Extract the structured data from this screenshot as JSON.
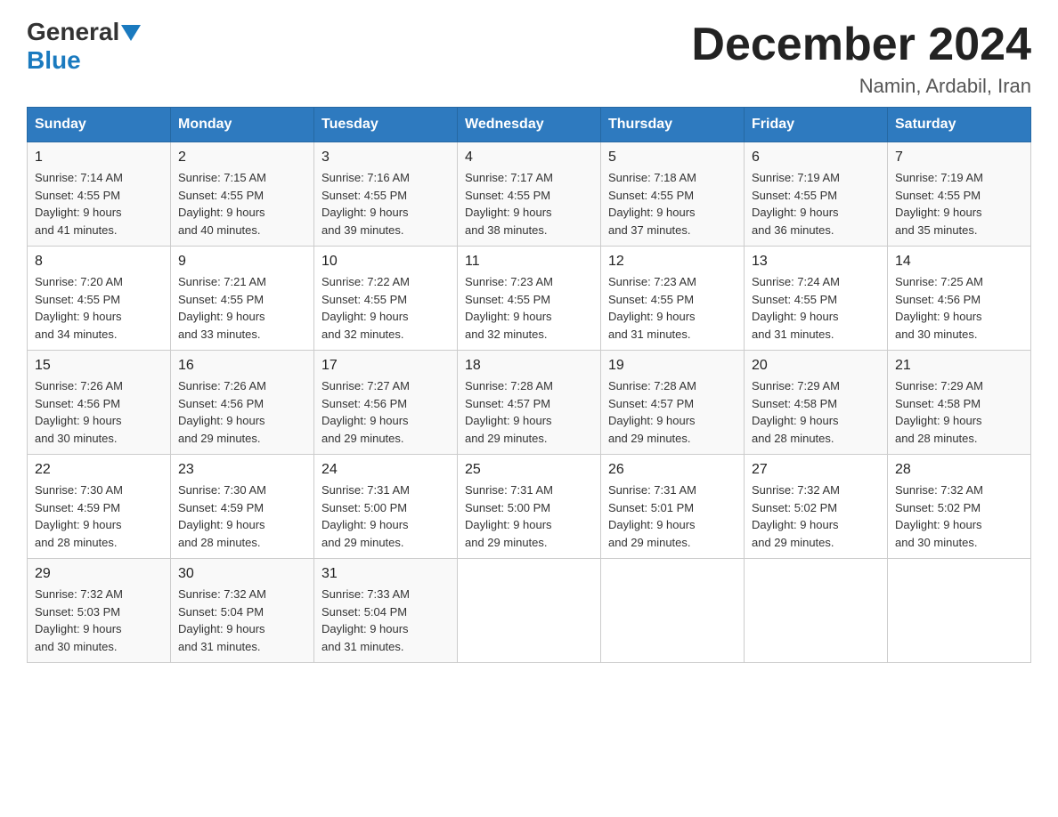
{
  "header": {
    "logo_general": "General",
    "logo_blue": "Blue",
    "month_title": "December 2024",
    "subtitle": "Namin, Ardabil, Iran"
  },
  "days_of_week": [
    "Sunday",
    "Monday",
    "Tuesday",
    "Wednesday",
    "Thursday",
    "Friday",
    "Saturday"
  ],
  "weeks": [
    [
      {
        "day": "1",
        "sunrise": "7:14 AM",
        "sunset": "4:55 PM",
        "daylight": "9 hours and 41 minutes."
      },
      {
        "day": "2",
        "sunrise": "7:15 AM",
        "sunset": "4:55 PM",
        "daylight": "9 hours and 40 minutes."
      },
      {
        "day": "3",
        "sunrise": "7:16 AM",
        "sunset": "4:55 PM",
        "daylight": "9 hours and 39 minutes."
      },
      {
        "day": "4",
        "sunrise": "7:17 AM",
        "sunset": "4:55 PM",
        "daylight": "9 hours and 38 minutes."
      },
      {
        "day": "5",
        "sunrise": "7:18 AM",
        "sunset": "4:55 PM",
        "daylight": "9 hours and 37 minutes."
      },
      {
        "day": "6",
        "sunrise": "7:19 AM",
        "sunset": "4:55 PM",
        "daylight": "9 hours and 36 minutes."
      },
      {
        "day": "7",
        "sunrise": "7:19 AM",
        "sunset": "4:55 PM",
        "daylight": "9 hours and 35 minutes."
      }
    ],
    [
      {
        "day": "8",
        "sunrise": "7:20 AM",
        "sunset": "4:55 PM",
        "daylight": "9 hours and 34 minutes."
      },
      {
        "day": "9",
        "sunrise": "7:21 AM",
        "sunset": "4:55 PM",
        "daylight": "9 hours and 33 minutes."
      },
      {
        "day": "10",
        "sunrise": "7:22 AM",
        "sunset": "4:55 PM",
        "daylight": "9 hours and 32 minutes."
      },
      {
        "day": "11",
        "sunrise": "7:23 AM",
        "sunset": "4:55 PM",
        "daylight": "9 hours and 32 minutes."
      },
      {
        "day": "12",
        "sunrise": "7:23 AM",
        "sunset": "4:55 PM",
        "daylight": "9 hours and 31 minutes."
      },
      {
        "day": "13",
        "sunrise": "7:24 AM",
        "sunset": "4:55 PM",
        "daylight": "9 hours and 31 minutes."
      },
      {
        "day": "14",
        "sunrise": "7:25 AM",
        "sunset": "4:56 PM",
        "daylight": "9 hours and 30 minutes."
      }
    ],
    [
      {
        "day": "15",
        "sunrise": "7:26 AM",
        "sunset": "4:56 PM",
        "daylight": "9 hours and 30 minutes."
      },
      {
        "day": "16",
        "sunrise": "7:26 AM",
        "sunset": "4:56 PM",
        "daylight": "9 hours and 29 minutes."
      },
      {
        "day": "17",
        "sunrise": "7:27 AM",
        "sunset": "4:56 PM",
        "daylight": "9 hours and 29 minutes."
      },
      {
        "day": "18",
        "sunrise": "7:28 AM",
        "sunset": "4:57 PM",
        "daylight": "9 hours and 29 minutes."
      },
      {
        "day": "19",
        "sunrise": "7:28 AM",
        "sunset": "4:57 PM",
        "daylight": "9 hours and 29 minutes."
      },
      {
        "day": "20",
        "sunrise": "7:29 AM",
        "sunset": "4:58 PM",
        "daylight": "9 hours and 28 minutes."
      },
      {
        "day": "21",
        "sunrise": "7:29 AM",
        "sunset": "4:58 PM",
        "daylight": "9 hours and 28 minutes."
      }
    ],
    [
      {
        "day": "22",
        "sunrise": "7:30 AM",
        "sunset": "4:59 PM",
        "daylight": "9 hours and 28 minutes."
      },
      {
        "day": "23",
        "sunrise": "7:30 AM",
        "sunset": "4:59 PM",
        "daylight": "9 hours and 28 minutes."
      },
      {
        "day": "24",
        "sunrise": "7:31 AM",
        "sunset": "5:00 PM",
        "daylight": "9 hours and 29 minutes."
      },
      {
        "day": "25",
        "sunrise": "7:31 AM",
        "sunset": "5:00 PM",
        "daylight": "9 hours and 29 minutes."
      },
      {
        "day": "26",
        "sunrise": "7:31 AM",
        "sunset": "5:01 PM",
        "daylight": "9 hours and 29 minutes."
      },
      {
        "day": "27",
        "sunrise": "7:32 AM",
        "sunset": "5:02 PM",
        "daylight": "9 hours and 29 minutes."
      },
      {
        "day": "28",
        "sunrise": "7:32 AM",
        "sunset": "5:02 PM",
        "daylight": "9 hours and 30 minutes."
      }
    ],
    [
      {
        "day": "29",
        "sunrise": "7:32 AM",
        "sunset": "5:03 PM",
        "daylight": "9 hours and 30 minutes."
      },
      {
        "day": "30",
        "sunrise": "7:32 AM",
        "sunset": "5:04 PM",
        "daylight": "9 hours and 31 minutes."
      },
      {
        "day": "31",
        "sunrise": "7:33 AM",
        "sunset": "5:04 PM",
        "daylight": "9 hours and 31 minutes."
      },
      null,
      null,
      null,
      null
    ]
  ],
  "labels": {
    "sunrise": "Sunrise:",
    "sunset": "Sunset:",
    "daylight": "Daylight:"
  }
}
